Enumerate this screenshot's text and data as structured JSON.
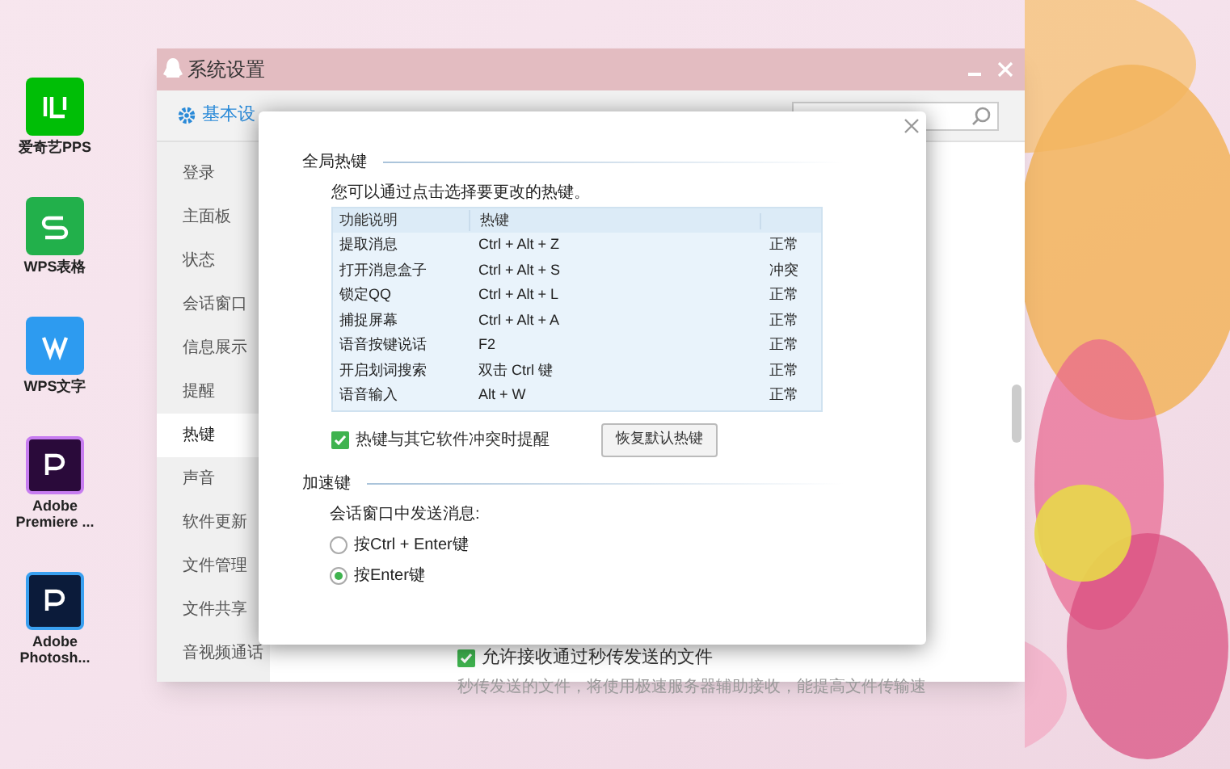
{
  "desktop_icons": [
    {
      "kind": "iqiyi",
      "label": "爱奇艺PPS"
    },
    {
      "kind": "wps-sheet",
      "label": "WPS表格"
    },
    {
      "kind": "wps-writer",
      "label": "WPS文字"
    },
    {
      "kind": "premiere",
      "label": "Adobe Premiere ..."
    },
    {
      "kind": "photoshop",
      "label": "Adobe Photosh..."
    }
  ],
  "settings_window": {
    "title": "系统设置",
    "tabs": [
      {
        "label": "基本设",
        "selected": true
      }
    ],
    "sidebar": {
      "items": [
        {
          "label": "登录",
          "selected": false
        },
        {
          "label": "主面板",
          "selected": false
        },
        {
          "label": "状态",
          "selected": false
        },
        {
          "label": "会话窗口",
          "selected": false
        },
        {
          "label": "信息展示",
          "selected": false
        },
        {
          "label": "提醒",
          "selected": false
        },
        {
          "label": "热键",
          "selected": true
        },
        {
          "label": "声音",
          "selected": false
        },
        {
          "label": "软件更新",
          "selected": false
        },
        {
          "label": "文件管理",
          "selected": false
        },
        {
          "label": "文件共享",
          "selected": false
        },
        {
          "label": "音视频通话",
          "selected": false
        }
      ]
    },
    "file_option": {
      "label": "允许接收通过秒传发送的文件",
      "checked": true,
      "description": "秒传发送的文件，将使用极速服务器辅助接收，能提高文件传输速"
    }
  },
  "hotkey_dialog": {
    "global_section": {
      "title": "全局热键",
      "hint": "您可以通过点击选择要更改的热键。",
      "table": {
        "columns": [
          "功能说明",
          "热键"
        ],
        "rows": [
          {
            "function": "提取消息",
            "hotkey": "Ctrl + Alt + Z",
            "status": "正常"
          },
          {
            "function": "打开消息盒子",
            "hotkey": "Ctrl + Alt + S",
            "status": "冲突"
          },
          {
            "function": "锁定QQ",
            "hotkey": "Ctrl + Alt + L",
            "status": "正常"
          },
          {
            "function": "捕捉屏幕",
            "hotkey": "Ctrl + Alt + A",
            "status": "正常"
          },
          {
            "function": "语音按键说话",
            "hotkey": "F2",
            "status": "正常"
          },
          {
            "function": "开启划词搜索",
            "hotkey": "双击 Ctrl 键",
            "status": "正常"
          },
          {
            "function": "语音输入",
            "hotkey": "Alt + W",
            "status": "正常"
          }
        ]
      },
      "conflict_reminder": {
        "label": "热键与其它软件冲突时提醒",
        "checked": true
      },
      "restore_button": "恢复默认热键"
    },
    "accel_section": {
      "title": "加速键",
      "prompt": "会话窗口中发送消息:",
      "options": [
        {
          "label": "按Ctrl + Enter键",
          "selected": false
        },
        {
          "label": "按Enter键",
          "selected": true
        }
      ]
    }
  }
}
